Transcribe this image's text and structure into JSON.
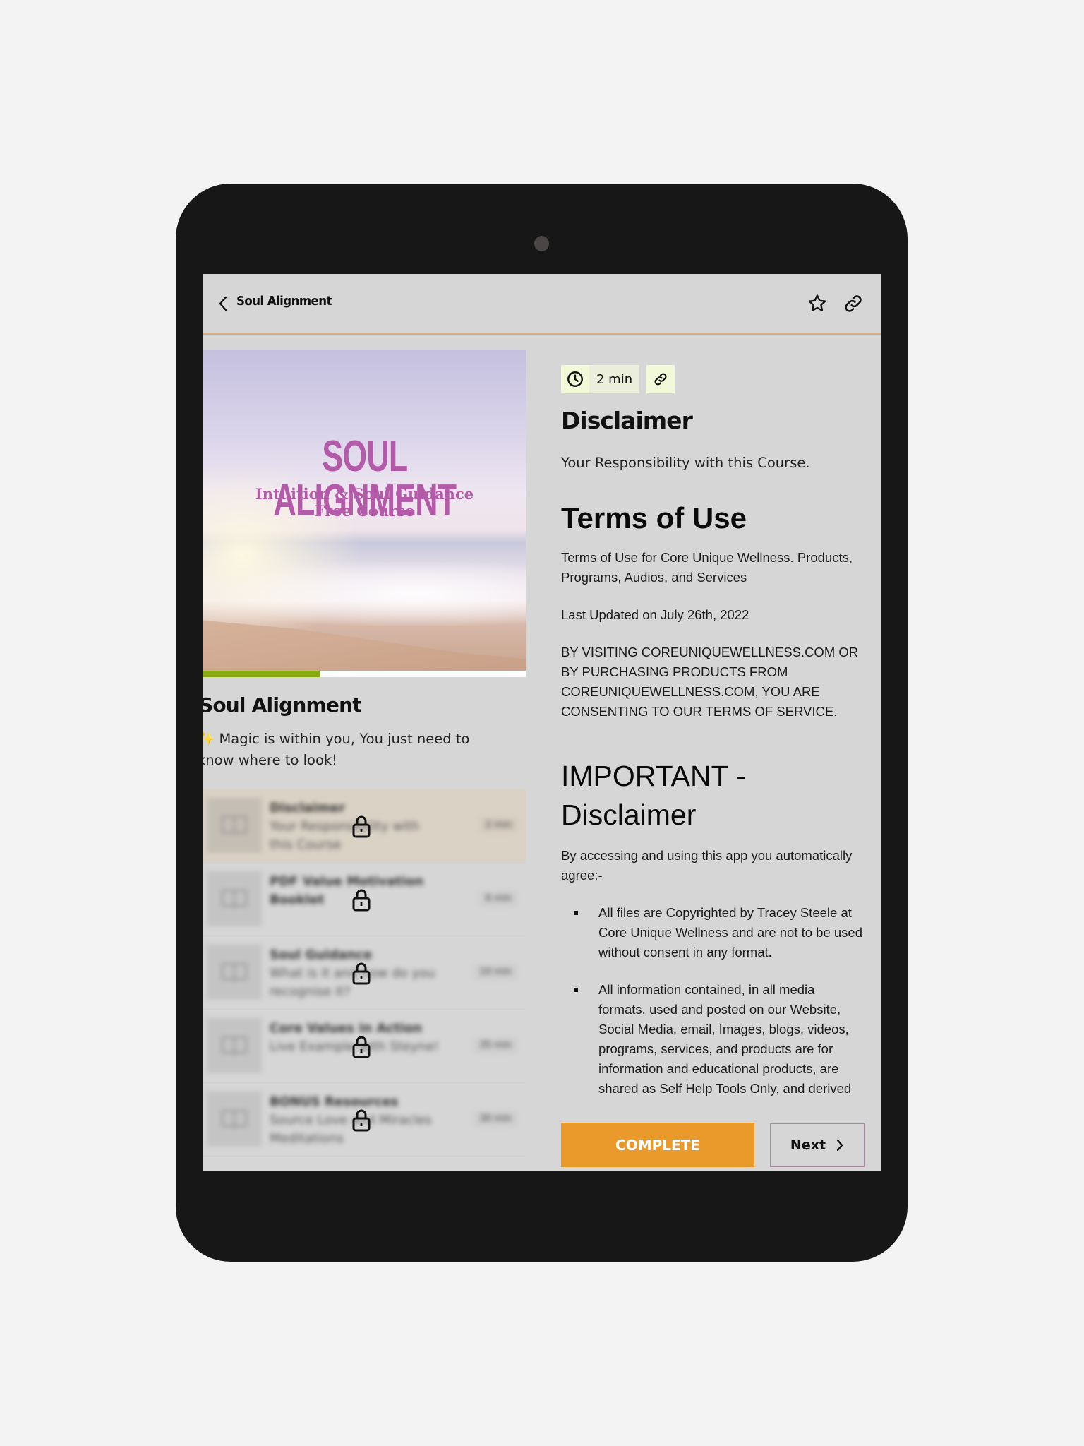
{
  "header": {
    "title": "Soul Alignment",
    "back_icon": "chevron-left-icon",
    "favorite_icon": "star-icon",
    "share_icon": "link-icon"
  },
  "course": {
    "cover": {
      "title": "SOUL ALIGNMENT",
      "subtitle_line1": "Intuition & Soul Guidance",
      "subtitle_line2": "Free Course"
    },
    "progress_percent": 36,
    "title": "Soul Alignment",
    "description": "✨ Magic is within you, You just need to know where to look!",
    "lessons": [
      {
        "title": "Disclaimer",
        "subtitle": "Your Responsibility with this Course",
        "duration": "2 min",
        "active": true,
        "locked": true
      },
      {
        "title": "PDF Value Motivation Booklet",
        "subtitle": "",
        "duration": "6 min",
        "active": false,
        "locked": true
      },
      {
        "title": "Soul Guidance",
        "subtitle": "What is it and how do you recognise it?",
        "duration": "10 min",
        "active": false,
        "locked": true
      },
      {
        "title": "Core Values in Action",
        "subtitle": "Live Example with Steyne!",
        "duration": "35 min",
        "active": false,
        "locked": true
      },
      {
        "title": "BONUS Resources",
        "subtitle": "Source Love and Miracles Meditations",
        "duration": "30 min",
        "active": false,
        "locked": true
      }
    ]
  },
  "lesson": {
    "duration": "2 min",
    "title": "Disclaimer",
    "subtitle": "Your Responsibility with this Course.",
    "body": {
      "heading1": "Terms of Use",
      "para1": "Terms of Use for Core Unique Wellness. Products, Programs, Audios, and Services",
      "para2": "Last Updated on July 26th, 2022",
      "para3": "BY VISITING COREUNIQUEWELLNESS.COM OR BY PURCHASING PRODUCTS FROM COREUNIQUEWELLNESS.COM, YOU ARE CONSENTING TO OUR TERMS OF SERVICE.",
      "heading2": "IMPORTANT - Disclaimer",
      "para4": "By accessing and using this app you automatically agree:-",
      "bullets": [
        "All files are Copyrighted by Tracey Steele at Core Unique Wellness and are not to be used without consent in any format.",
        "All information contained, in all media formats, used and posted on our Website, Social Media, email, Images, blogs, videos, programs, services, and products are for information and educational products, are shared as Self Help Tools Only, and derived"
      ]
    }
  },
  "actions": {
    "complete_label": "COMPLETE",
    "next_label": "Next"
  },
  "colors": {
    "accent_orange": "#ea9a2a",
    "progress_green": "#8aaa14",
    "header_divider": "#dcb07a",
    "cover_text": "#b35aa8",
    "meta_chip": "#f1f9d8"
  }
}
